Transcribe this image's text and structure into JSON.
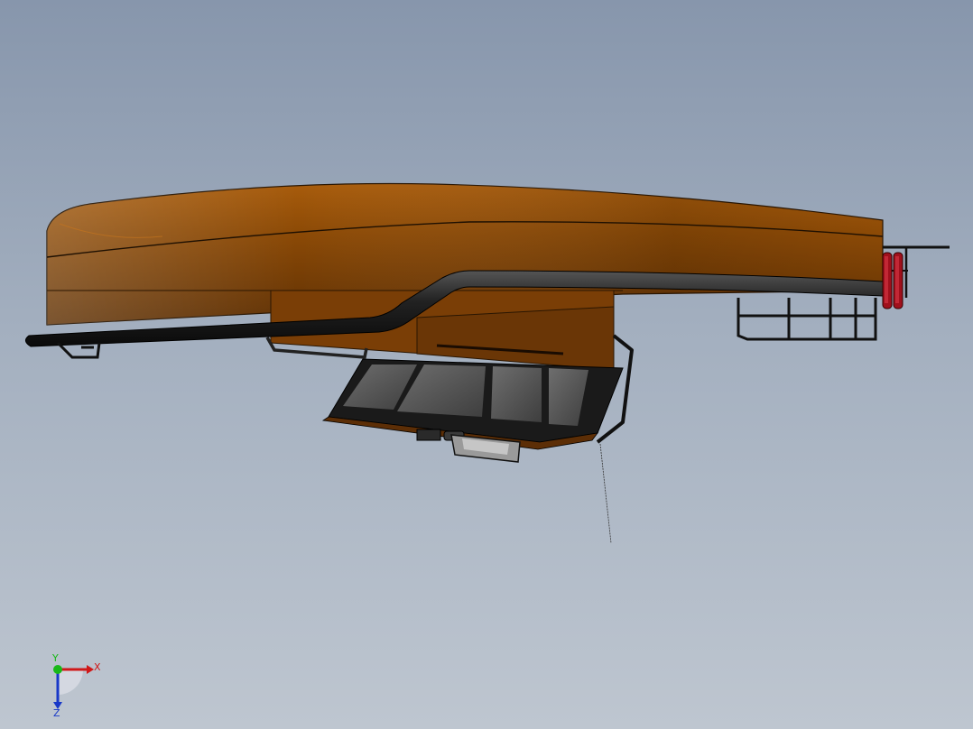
{
  "viewport": {
    "background_top": "#8796ac",
    "background_bottom": "#bec6d0"
  },
  "model": {
    "hull_color": "#8a4a08",
    "hull_highlight": "#b0650f",
    "fender_color": "#1c1c1c",
    "cabin_frame_color": "#141414",
    "glass_color": "#5a5a5a",
    "extinguisher_color": "#a0101c"
  },
  "triad": {
    "x_label": "X",
    "y_label": "Y",
    "z_label": "Z",
    "x_color": "#d01818",
    "y_color": "#18b818",
    "z_color": "#1838c8"
  }
}
